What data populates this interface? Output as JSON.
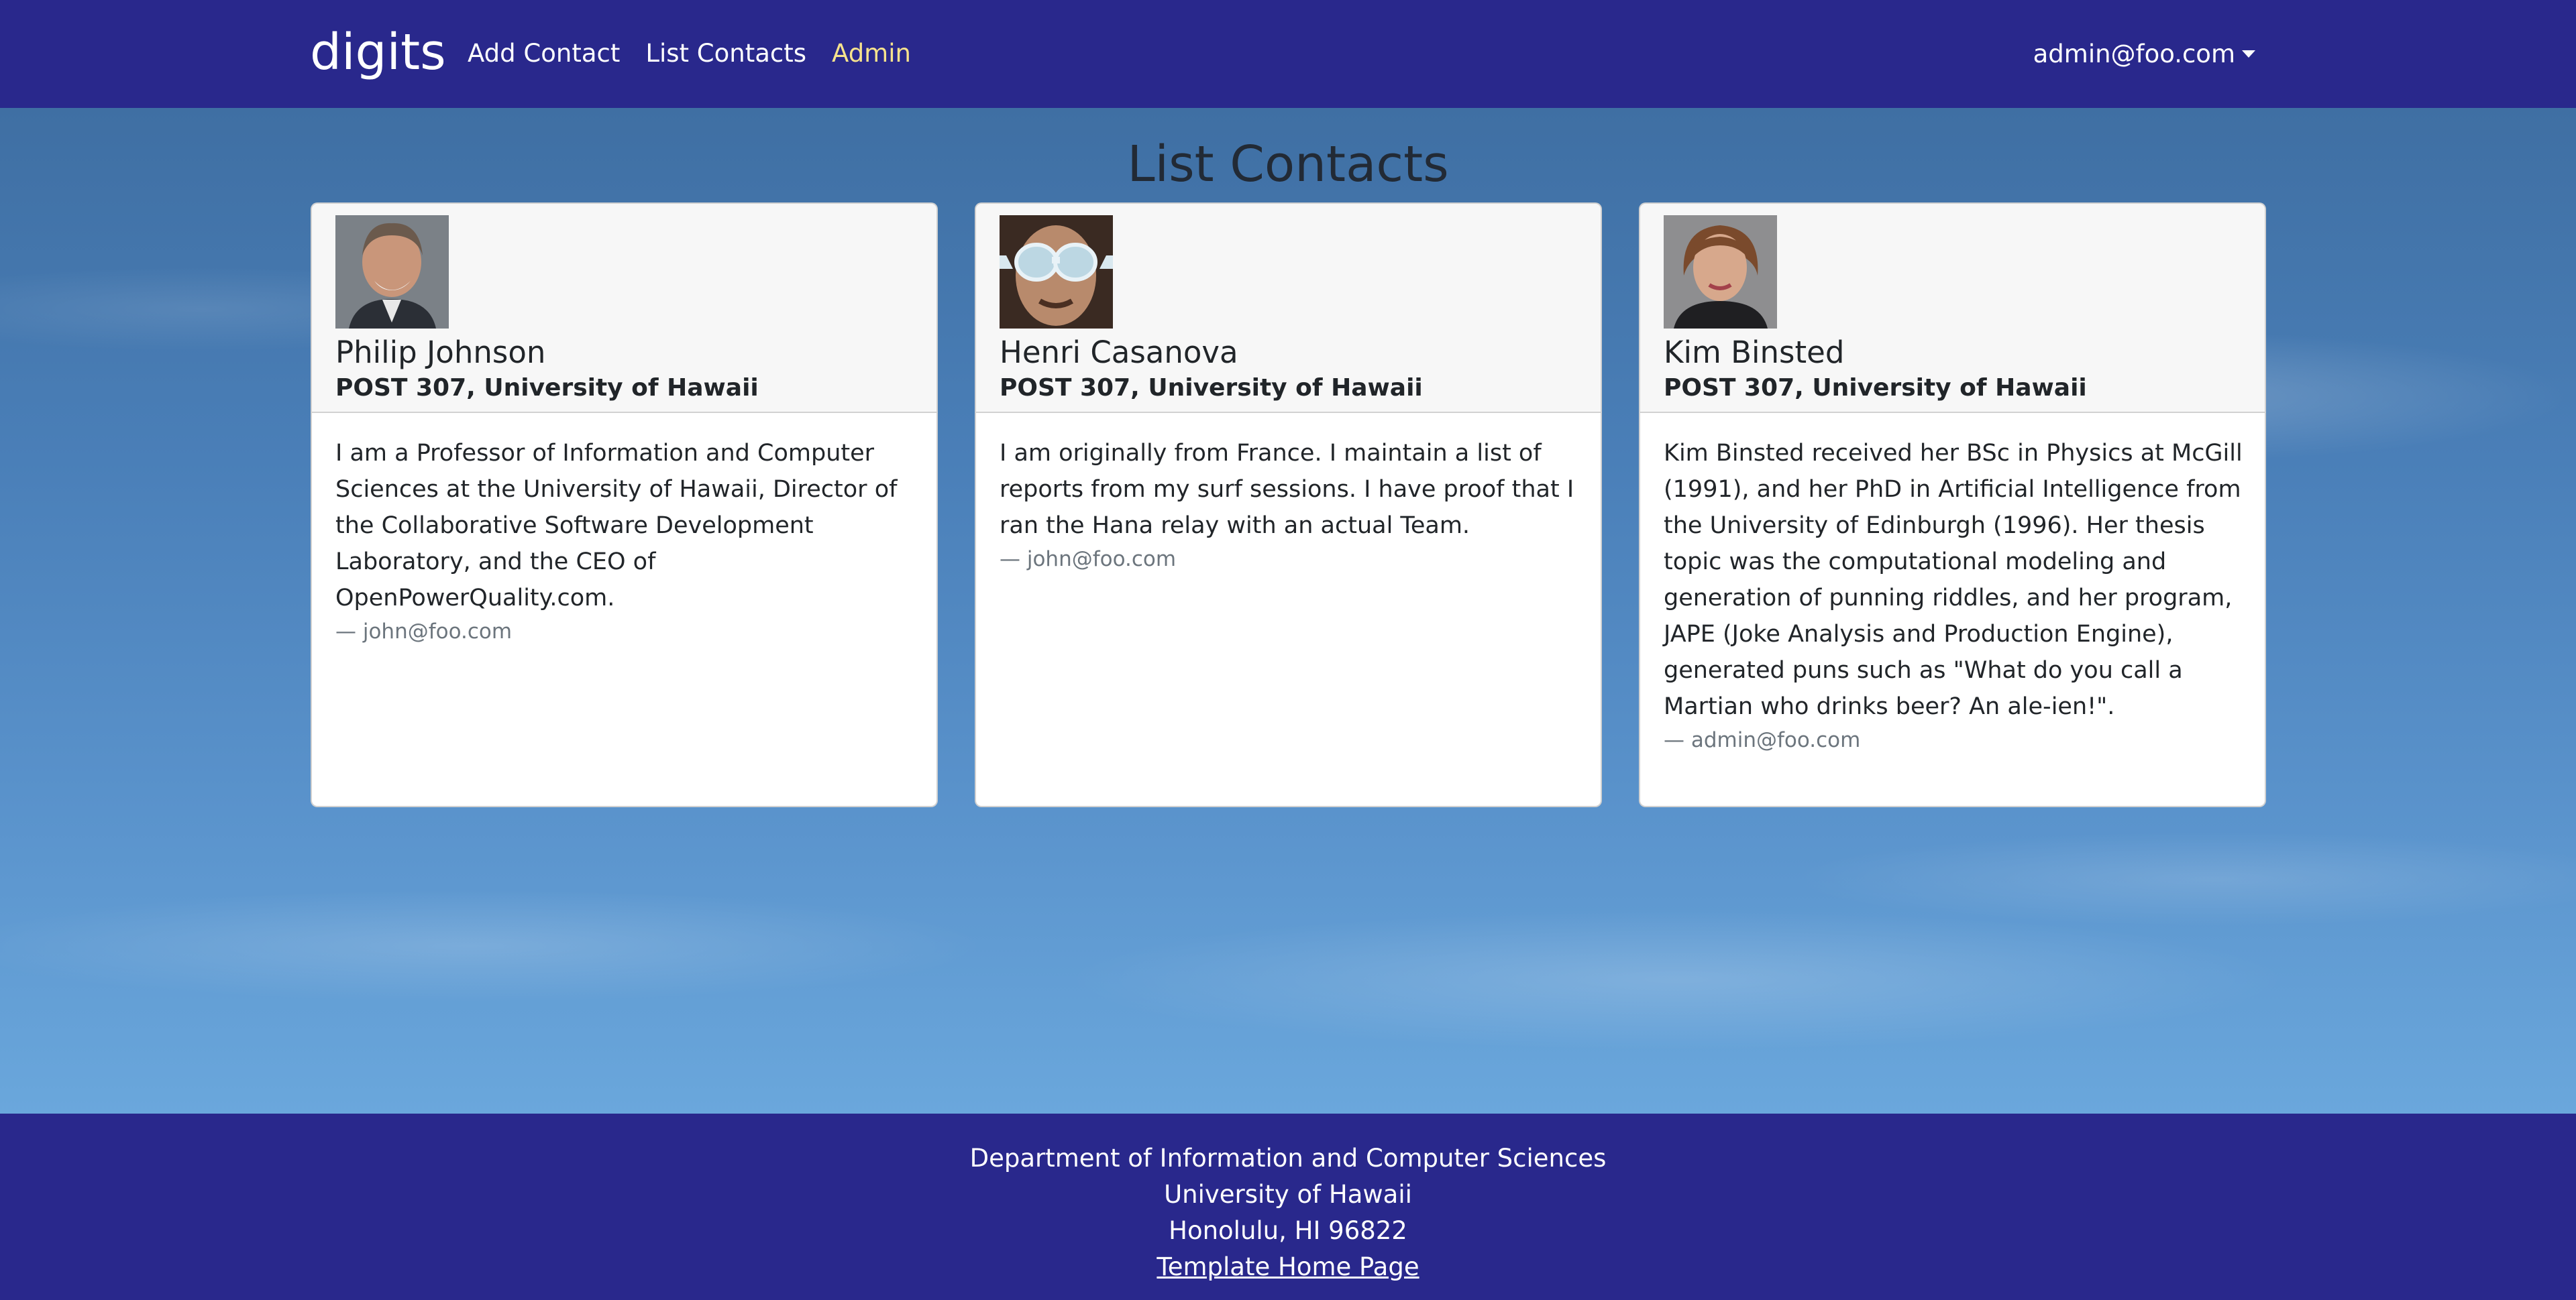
{
  "navbar": {
    "brand": "digits",
    "links": [
      {
        "label": "Add Contact"
      },
      {
        "label": "List Contacts"
      },
      {
        "label": "Admin"
      }
    ],
    "user": "admin@foo.com"
  },
  "main": {
    "title": "List Contacts",
    "contacts": [
      {
        "name": "Philip Johnson",
        "address": "POST 307, University of Hawaii",
        "description": "I am a Professor of Information and Computer Sciences at the University of Hawaii, Director of the Collaborative Software Development Laboratory, and the CEO of OpenPowerQuality.com.",
        "owner": "— john@foo.com"
      },
      {
        "name": "Henri Casanova",
        "address": "POST 307, University of Hawaii",
        "description": "I am originally from France. I maintain a list of reports from my surf sessions. I have proof that I ran the Hana relay with an actual Team.",
        "owner": "— john@foo.com"
      },
      {
        "name": "Kim Binsted",
        "address": "POST 307, University of Hawaii",
        "description": "Kim Binsted received her BSc in Physics at McGill (1991), and her PhD in Artificial Intelligence from the University of Edinburgh (1996). Her thesis topic was the computational modeling and generation of punning riddles, and her program, JAPE (Joke Analysis and Production Engine), generated puns such as \"What do you call a Martian who drinks beer? An ale-ien!\".",
        "owner": "— admin@foo.com"
      }
    ]
  },
  "footer": {
    "line1": "Department of Information and Computer Sciences",
    "line2": "University of Hawaii",
    "line3": "Honolulu, HI 96822",
    "link": "Template Home Page"
  },
  "colors": {
    "navbar_bg": "#29288c",
    "active_link": "#f7e38d"
  }
}
